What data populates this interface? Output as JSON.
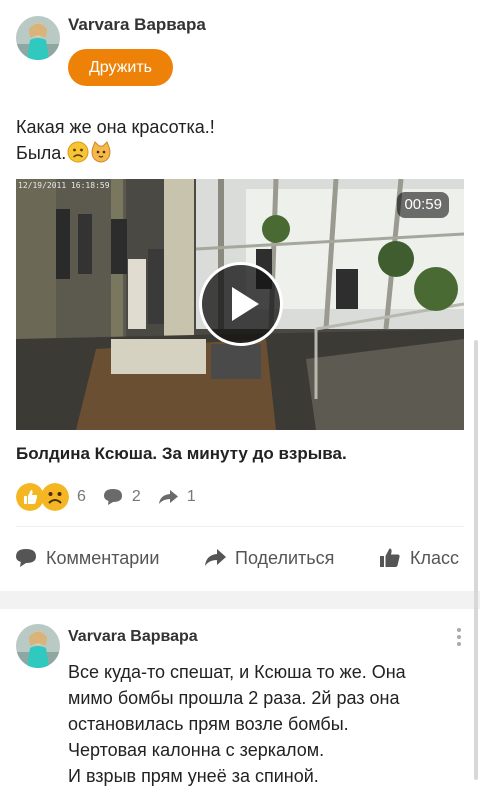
{
  "post": {
    "author_name": "Varvara Варвара",
    "friend_button_label": "Дружить",
    "text_lines": [
      "Какая же она красотка.!",
      "Была."
    ],
    "video": {
      "duration": "00:59",
      "camera_stamp": "12/19/2011 16:18:59",
      "title": "Болдина Ксюша. За минуту до взрыва."
    },
    "stats": {
      "reactions_count": "6",
      "comments_count": "2",
      "shares_count": "1"
    },
    "actions": {
      "comments_label": "Комментарии",
      "share_label": "Поделиться",
      "like_label": "Класс"
    }
  },
  "comment": {
    "author_name": "Varvara Варвара",
    "text_lines": [
      "Все куда-то спешат, и Ксюша то же. Она",
      "мимо бомбы прошла 2 раза. 2й раз она",
      "остановилась прям возле бомбы.",
      "Чертовая калонна с зеркалом.",
      "И взрыв прям унеё за спиной."
    ]
  },
  "colors": {
    "accent_orange": "#ee8208",
    "reaction_yellow": "#f5b623",
    "divider": "#eeeeee",
    "icon_grey": "#555555"
  },
  "icons": [
    "avatar-photo",
    "sad-face-emoji",
    "cat-emoji",
    "play-icon",
    "thumbs-up-icon",
    "sad-face-icon",
    "speech-bubble-icon",
    "share-arrow-icon",
    "more-vertical-icon"
  ]
}
